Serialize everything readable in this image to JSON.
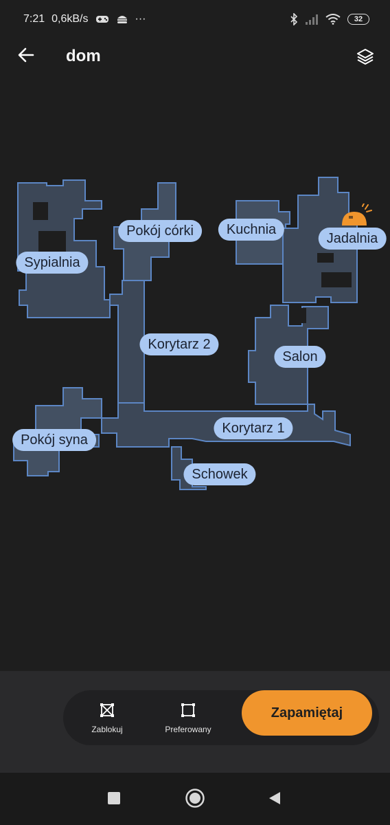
{
  "status_bar": {
    "time": "7:21",
    "network_speed": "0,6kB/s",
    "more": "···",
    "battery": "32",
    "icons": [
      "gamepad-icon",
      "burger-icon",
      "bluetooth-icon",
      "signal-icon",
      "wifi-icon",
      "battery-icon"
    ]
  },
  "header": {
    "title": "dom",
    "back_icon": "arrow-left-icon",
    "layers_icon": "layers-icon"
  },
  "map": {
    "rooms": [
      {
        "name": "Sypialnia"
      },
      {
        "name": "Pokój córki"
      },
      {
        "name": "Kuchnia"
      },
      {
        "name": "Jadalnia"
      },
      {
        "name": "Korytarz 2"
      },
      {
        "name": "Salon"
      },
      {
        "name": "Pokój syna"
      },
      {
        "name": "Korytarz 1"
      },
      {
        "name": "Schowek"
      }
    ],
    "colors": {
      "room_fill": "#3c4757",
      "room_border": "#5c86c4",
      "label_bg": "#aac8f2",
      "dock": "#f0952d"
    }
  },
  "toolbar": {
    "block_label": "Zablokuj",
    "preferred_label": "Preferowany",
    "save_label": "Zapamiętaj",
    "accent": "#f0952d"
  },
  "nav": {
    "icons": [
      "square-icon",
      "circle-home-icon",
      "triangle-back-icon"
    ]
  }
}
